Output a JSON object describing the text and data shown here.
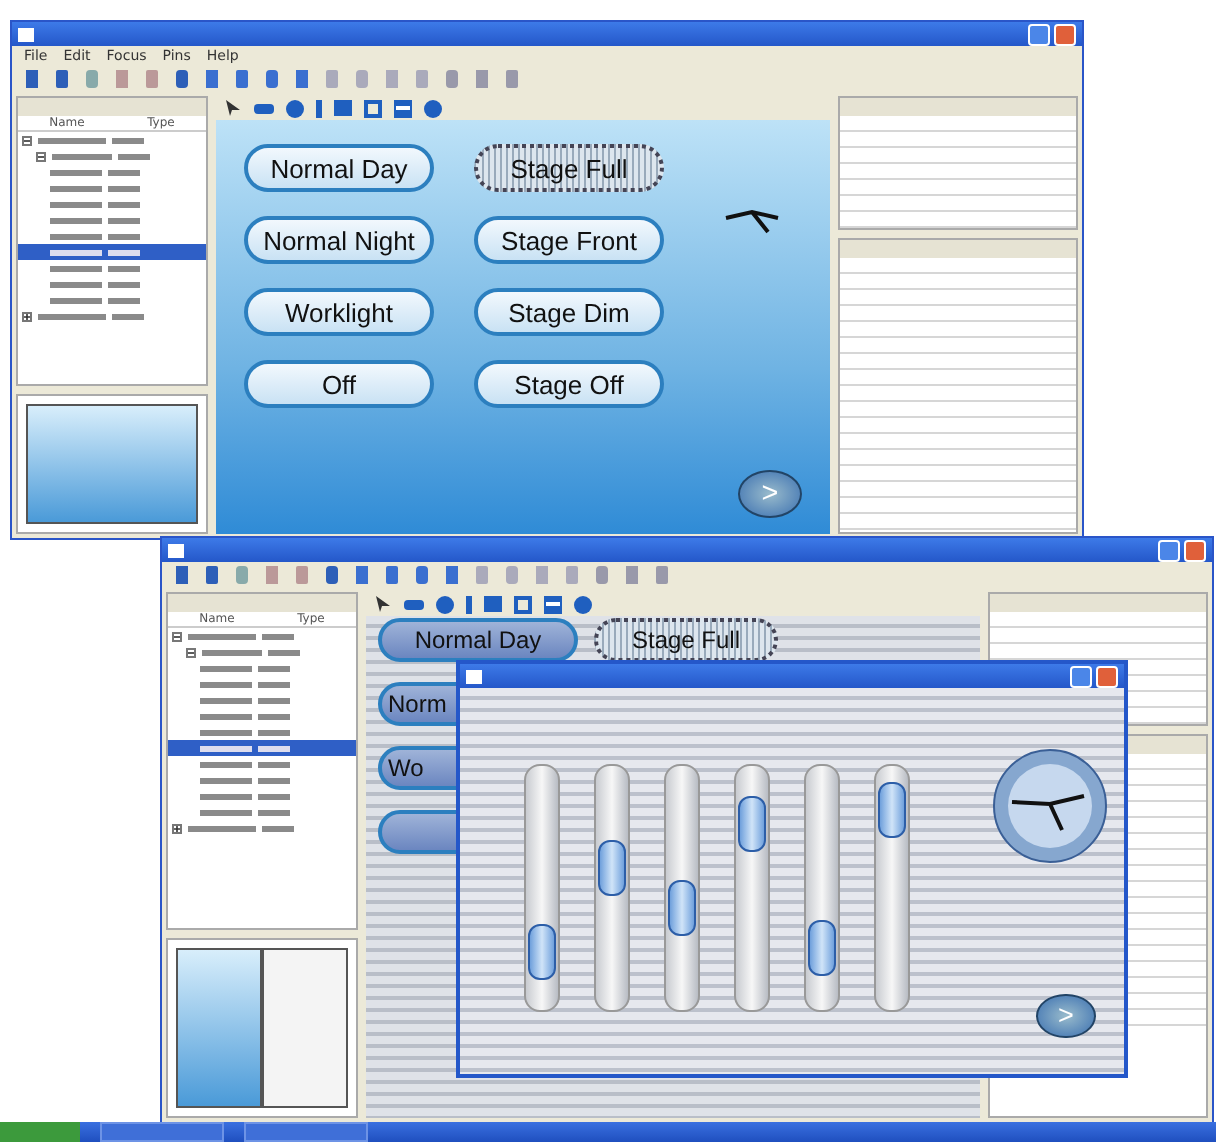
{
  "top_window": {
    "menu": [
      "File",
      "Edit",
      "Focus",
      "Pins",
      "Help"
    ],
    "tree_columns": [
      "Name",
      "Type"
    ],
    "tree": [
      {
        "expanded": true,
        "selected": false,
        "children": [
          {
            "expanded": true,
            "selected": false,
            "children": [
              {
                "selected": false
              },
              {
                "selected": false
              },
              {
                "selected": false
              },
              {
                "selected": false
              },
              {
                "selected": false
              },
              {
                "selected": true
              },
              {
                "selected": false
              },
              {
                "selected": false
              },
              {
                "selected": false
              }
            ]
          }
        ]
      },
      {
        "expanded": false,
        "selected": false
      }
    ],
    "buttons": [
      {
        "label": "Normal Day",
        "selected": false
      },
      {
        "label": "Stage Full",
        "selected": true
      },
      {
        "label": "Normal Night",
        "selected": false
      },
      {
        "label": "Stage Front",
        "selected": false
      },
      {
        "label": "Worklight",
        "selected": false
      },
      {
        "label": "Stage Dim",
        "selected": false
      },
      {
        "label": "Off",
        "selected": false
      },
      {
        "label": "Stage Off",
        "selected": false
      }
    ],
    "next": ">"
  },
  "bottom_window": {
    "tree_columns": [
      "Name",
      "Type"
    ],
    "tree": [
      {
        "expanded": true,
        "selected": false,
        "children": [
          {
            "expanded": true,
            "selected": false,
            "children": [
              {
                "selected": false
              },
              {
                "selected": false
              },
              {
                "selected": false
              },
              {
                "selected": false
              },
              {
                "selected": false
              },
              {
                "selected": true
              },
              {
                "selected": false
              },
              {
                "selected": false
              },
              {
                "selected": false
              },
              {
                "selected": false
              }
            ]
          }
        ]
      },
      {
        "expanded": false,
        "selected": false
      }
    ],
    "buttons": [
      {
        "label": "Normal Day",
        "selected": false
      },
      {
        "label": "Stage Full",
        "selected": true
      },
      {
        "label": "Norm",
        "selected": false
      },
      {
        "label": "Wo",
        "selected": false
      },
      {
        "selected": false
      }
    ]
  },
  "dialog": {
    "sliders": [
      {
        "level": 0.16
      },
      {
        "level": 0.59
      },
      {
        "level": 0.39
      },
      {
        "level": 0.82
      },
      {
        "level": 0.18
      },
      {
        "level": 0.9
      }
    ],
    "next": ">"
  }
}
